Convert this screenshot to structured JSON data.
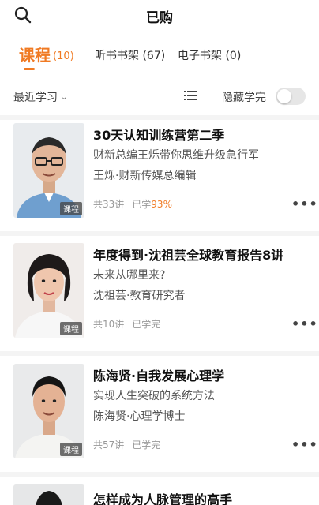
{
  "header": {
    "title": "已购",
    "search_icon": "search-icon"
  },
  "tabs": [
    {
      "label": "课程",
      "count": "(10)",
      "active": true
    },
    {
      "label": "听书书架",
      "count": "(67)",
      "active": false
    },
    {
      "label": "电子书架",
      "count": "(0)",
      "active": false
    }
  ],
  "filters": {
    "sort_label": "最近学习",
    "list_view_icon": "list-view-icon",
    "hide_finished_label": "隐藏学完",
    "hide_finished_on": false
  },
  "colors": {
    "accent": "#f07a23",
    "text_primary": "#111111",
    "text_secondary": "#555555",
    "text_muted": "#999999",
    "divider": "#f4f4f4"
  },
  "courses": [
    {
      "title": "30天认知训练营第二季",
      "subtitle": "财新总编王烁带你思维升级急行军",
      "author": "王烁·财新传媒总编辑",
      "lessons": "共33讲",
      "progress_prefix": "已学",
      "progress_value": "93%",
      "badge": "课程"
    },
    {
      "title": "年度得到·沈祖芸全球教育报告8讲",
      "subtitle": "未来从哪里来?",
      "author": "沈祖芸·教育研究者",
      "lessons": "共10讲",
      "progress_prefix": "已学完",
      "progress_value": "",
      "badge": "课程"
    },
    {
      "title": "陈海贤·自我发展心理学",
      "subtitle": "实现人生突破的系统方法",
      "author": "陈海贤·心理学博士",
      "lessons": "共57讲",
      "progress_prefix": "已学完",
      "progress_value": "",
      "badge": "课程"
    },
    {
      "title": "怎样成为人脉管理的高手"
    }
  ]
}
